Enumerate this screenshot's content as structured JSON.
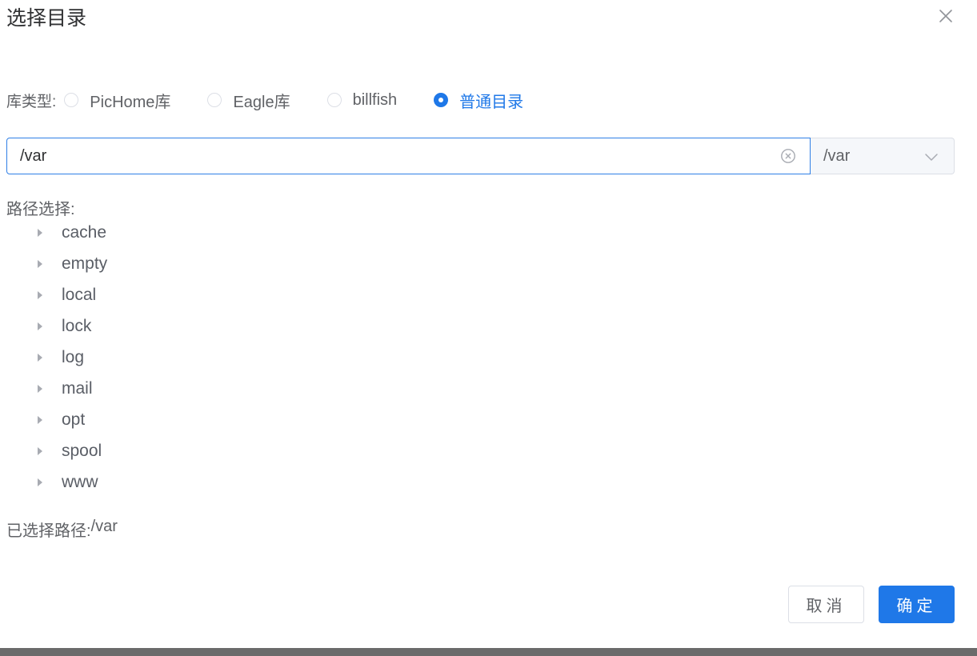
{
  "dialog": {
    "title": "选择目录"
  },
  "library_type": {
    "label": "库类型:",
    "options": [
      {
        "label": "PicHome库",
        "checked": false
      },
      {
        "label": "Eagle库",
        "checked": false
      },
      {
        "label": "billfish",
        "checked": false
      },
      {
        "label": "普通目录",
        "checked": true
      }
    ]
  },
  "path_input": {
    "value": "/var"
  },
  "root_select": {
    "value": "/var"
  },
  "path_tree": {
    "label": "路径选择:",
    "nodes": [
      "cache",
      "empty",
      "local",
      "lock",
      "log",
      "mail",
      "opt",
      "spool",
      "www"
    ]
  },
  "selected": {
    "label": "已选择路径:",
    "value": "/var"
  },
  "footer": {
    "cancel_label": "取消",
    "confirm_label": "确定"
  },
  "colors": {
    "primary": "#1f78e8",
    "border": "#dcdfe6",
    "text": "#606266"
  },
  "icons": {
    "close": "close-icon",
    "clear": "circle-close-icon",
    "dropdown": "chevron-down-icon",
    "tree_expand": "caret-right-icon"
  }
}
